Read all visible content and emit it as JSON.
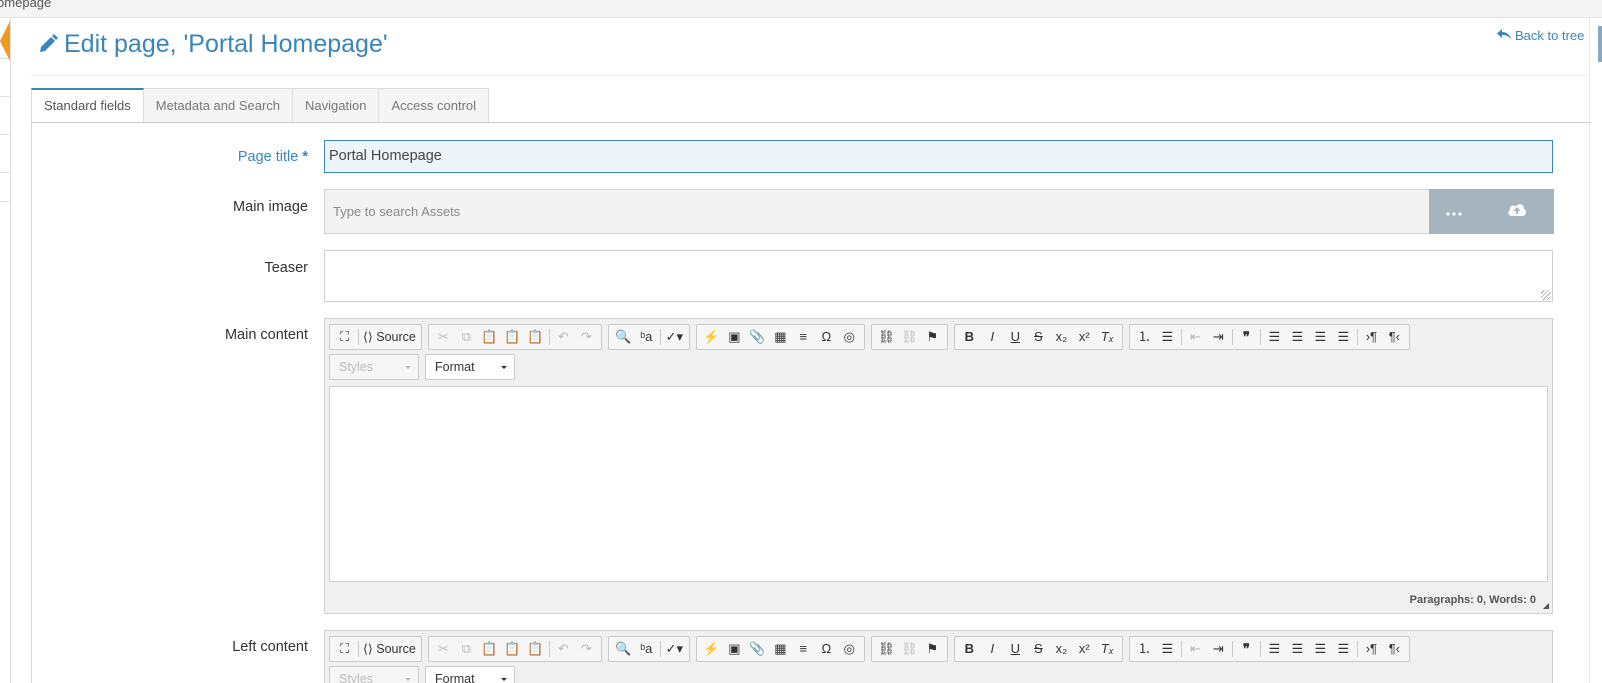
{
  "breadcrumb": "rtal Homepage",
  "page_heading": "Edit page, 'Portal Homepage'",
  "back_link": "Back to tree",
  "tabs": [
    {
      "label": "Standard fields",
      "active": true
    },
    {
      "label": "Metadata and Search",
      "active": false
    },
    {
      "label": "Navigation",
      "active": false
    },
    {
      "label": "Access control",
      "active": false
    }
  ],
  "fields": {
    "page_title": {
      "label": "Page title",
      "required_marker": "*",
      "value": "Portal Homepage"
    },
    "main_image": {
      "label": "Main image",
      "placeholder": "Type to search Assets",
      "browse_icon": "ellipsis-icon",
      "upload_icon": "cloud-upload-icon"
    },
    "teaser": {
      "label": "Teaser",
      "value": ""
    },
    "main_content": {
      "label": "Main content",
      "status": "Paragraphs: 0, Words: 0"
    },
    "left_content": {
      "label": "Left content"
    }
  },
  "editor_toolbar": {
    "source_label": "Source",
    "styles_label": "Styles",
    "format_label": "Format"
  },
  "colors": {
    "accent": "#3a85bd",
    "collapse_tab": "#f29a1f",
    "asset_buttons": "#a5b4bf"
  }
}
